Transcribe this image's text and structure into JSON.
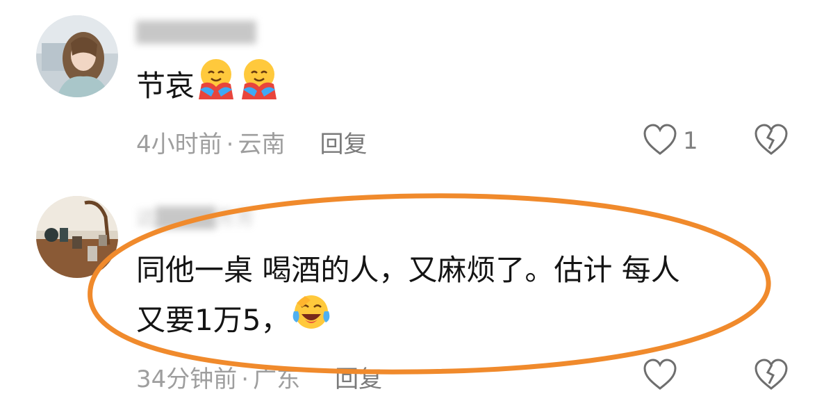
{
  "comments": [
    {
      "username": "████████",
      "text": "节哀",
      "emoji": [
        "hugging-face-icon",
        "hugging-face-icon"
      ],
      "time": "4小时前",
      "separator": "·",
      "location": "云南",
      "reply_label": "回复",
      "likes": "1"
    },
    {
      "username": "这████芳芳",
      "text_line1": "同他一桌 喝酒的人，又麻烦了。估计 每人",
      "text_line2": "又要1万5，",
      "emoji": [
        "tears-of-joy-icon"
      ],
      "time": "34分钟前",
      "separator": "·",
      "location": "广东",
      "reply_label": "回复"
    }
  ],
  "colors": {
    "highlight_ring": "#F08A2C",
    "meta_text": "#9E9E9E",
    "body_text": "#141414"
  }
}
